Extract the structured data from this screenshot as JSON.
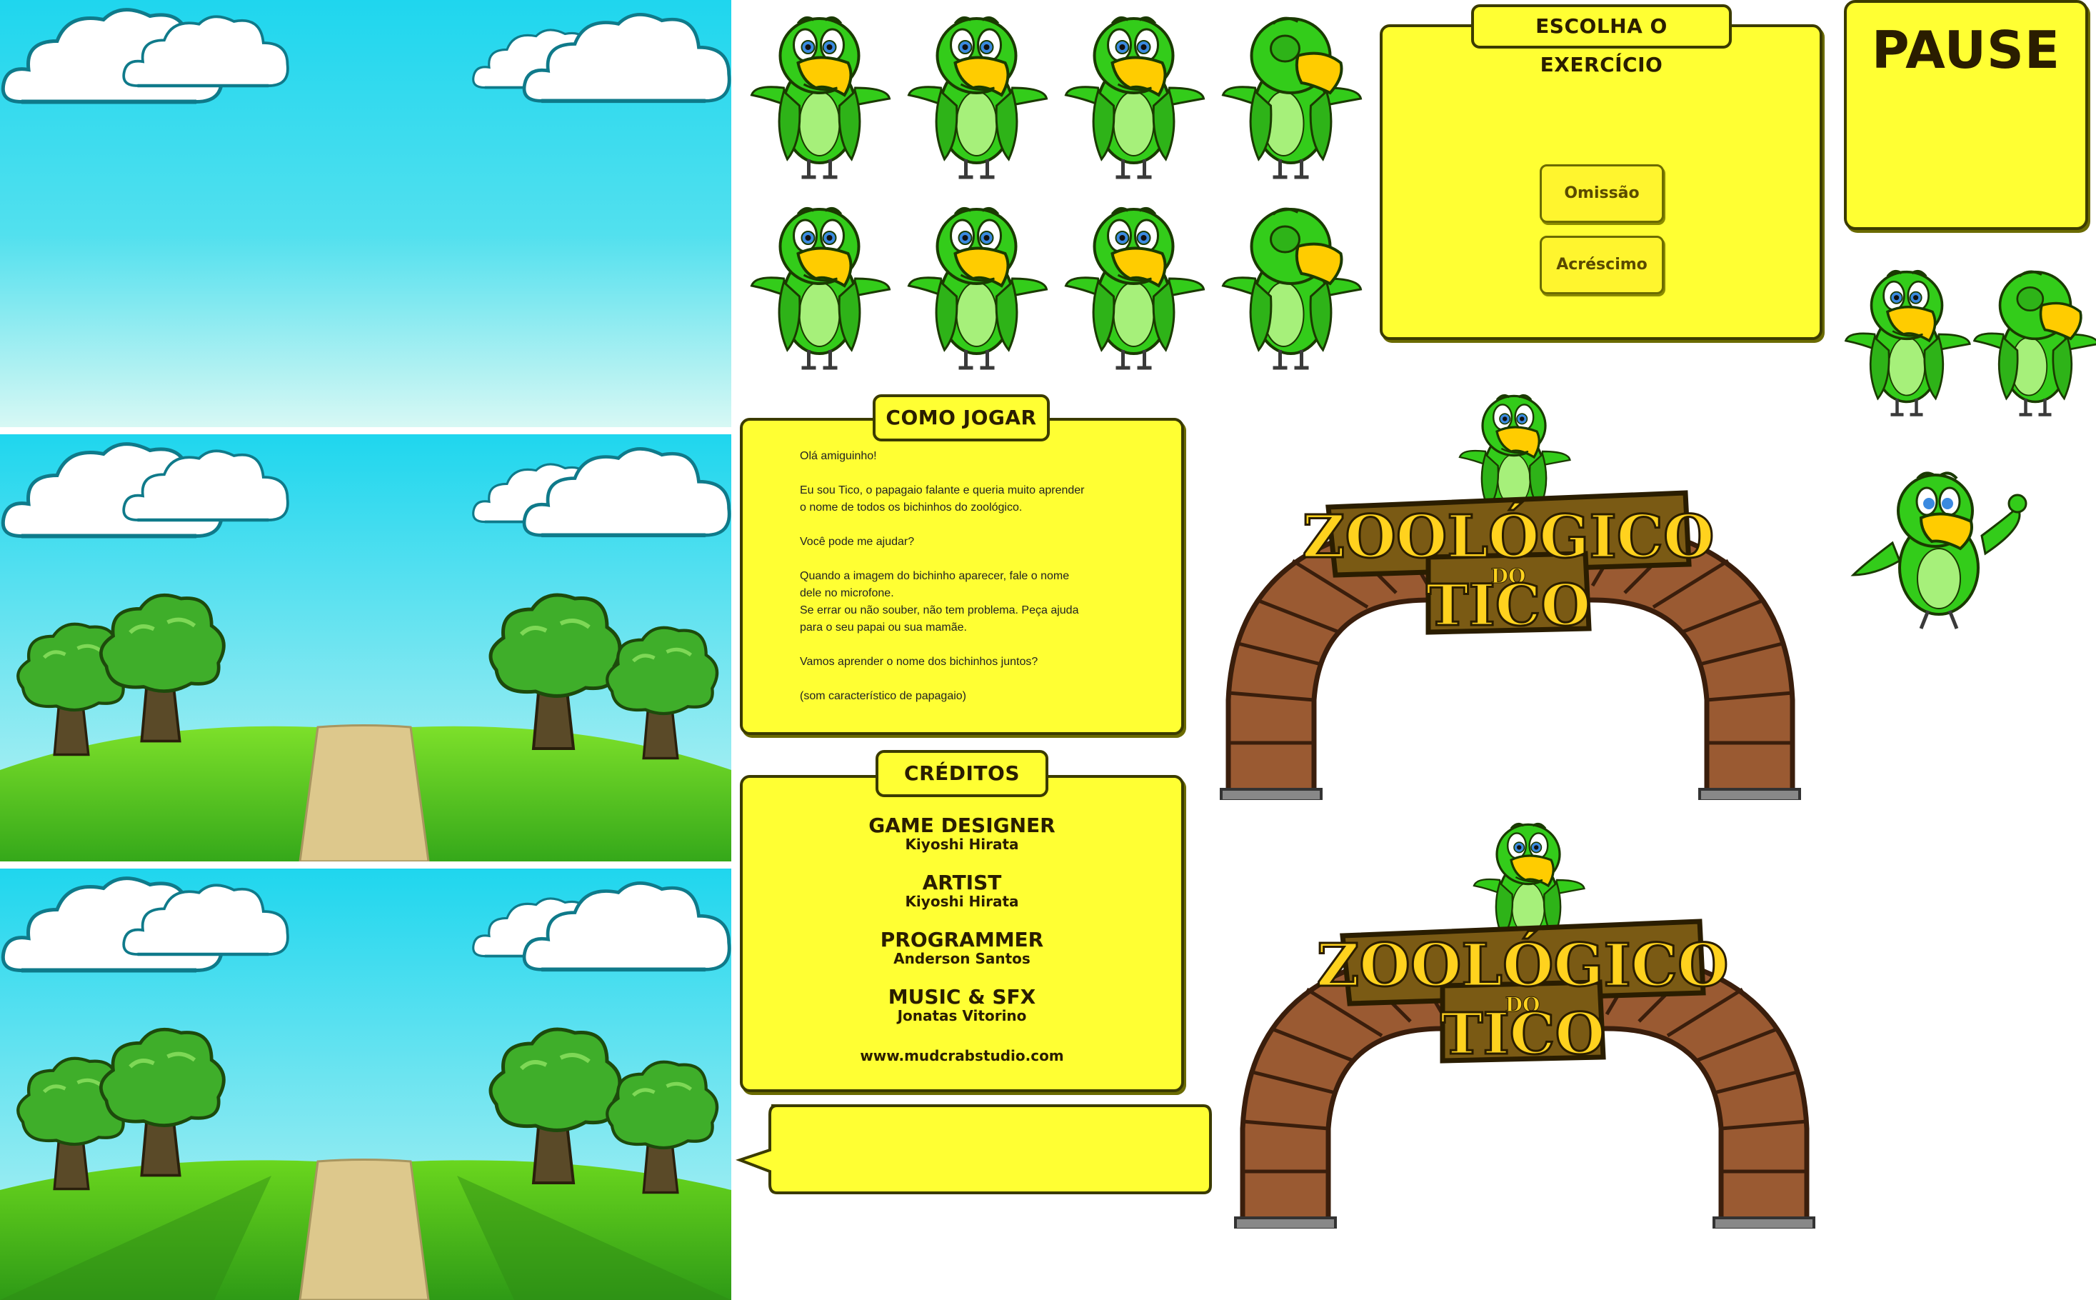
{
  "exercise_panel": {
    "title": "ESCOLHA O EXERCÍCIO",
    "buttons": [
      "Omissão",
      "Acréscimo"
    ]
  },
  "pause_panel": {
    "title": "PAUSE"
  },
  "how_to_play": {
    "title": "COMO JOGAR",
    "lines": [
      "Olá amiguinho!",
      "",
      "Eu sou Tico, o papagaio falante e queria muito aprender",
      "o nome de todos os bichinhos do zoológico.",
      "",
      "Você pode me ajudar?",
      "",
      "Quando a imagem do bichinho aparecer, fale o nome",
      "dele no microfone.",
      "Se errar ou não souber, não tem problema. Peça ajuda",
      "para o seu papai ou sua mamãe.",
      "",
      "Vamos aprender o nome dos bichinhos juntos?",
      "",
      "(som característico de papagaio)"
    ]
  },
  "credits": {
    "title": "CRÉDITOS",
    "entries": [
      {
        "role": "GAME DESIGNER",
        "name": "Kiyoshi Hirata"
      },
      {
        "role": "ARTIST",
        "name": "Kiyoshi Hirata"
      },
      {
        "role": "PROGRAMMER",
        "name": "Anderson Santos"
      },
      {
        "role": "MUSIC & SFX",
        "name": "Jonatas Vitorino"
      }
    ],
    "website": "www.mudcrabstudio.com"
  },
  "logo": {
    "line1": "ZOOLÓGICO",
    "line2": "DO",
    "line3": "TICO"
  },
  "speech_bubble": {
    "text": ""
  },
  "colors": {
    "panel_yellow": "#ffff33",
    "panel_border": "#3b3b00",
    "parrot_green": "#33cc1a",
    "parrot_beak": "#ffcc00",
    "sky_top": "#1fd6ee",
    "grass": "#44c21a",
    "arch_brick": "#9a5a32",
    "sign_wood": "#7a5a14"
  },
  "icons": {
    "character": "parrot-tico-icon",
    "scenery_cloud": "cloud-icon",
    "scenery_tree": "tree-icon"
  }
}
